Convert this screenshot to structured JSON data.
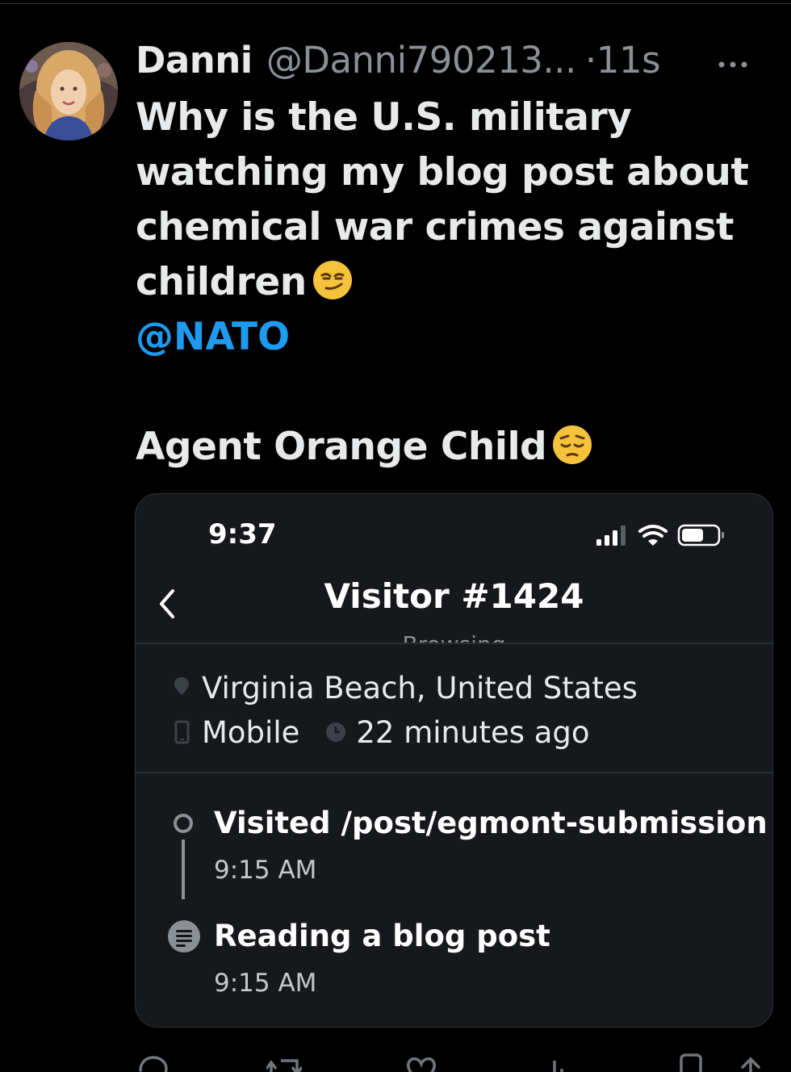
{
  "tweet": {
    "display_name": "Danni",
    "handle": "@Danni790213...",
    "separator": "·",
    "time": "11s",
    "more_icon": "more-horizontal-icon",
    "text": "Why is the U.S. military watching my blog post about chemical war crimes against children",
    "text_emoji": "smirking-face-emoji",
    "mention": "@NATO",
    "second_line": "Agent Orange Child",
    "second_emoji": "pensive-face-emoji"
  },
  "embedded_screenshot": {
    "status_time": "9:37",
    "status_icons": [
      "signal-bars-icon",
      "wifi-icon",
      "battery-icon"
    ],
    "back_icon": "chevron-left-icon",
    "title": "Visitor #1424",
    "subtitle": "Browsing",
    "location": "Virginia Beach, United States",
    "device": "Mobile",
    "last_seen": "22 minutes ago",
    "events": [
      {
        "title": "Visited /post/egmont-submission",
        "time": "9:15 AM",
        "icon": "circle-outline-icon"
      },
      {
        "title": "Reading a blog post",
        "time": "9:15 AM",
        "icon": "document-lines-icon"
      }
    ]
  },
  "actions": [
    "reply-icon",
    "retweet-icon",
    "like-icon",
    "views-icon",
    "bookmark-icon",
    "share-icon"
  ],
  "colors": {
    "background": "#000000",
    "text": "#e7e9ea",
    "muted": "#8b9096",
    "link": "#1d9bf0",
    "card": "#16181b"
  }
}
